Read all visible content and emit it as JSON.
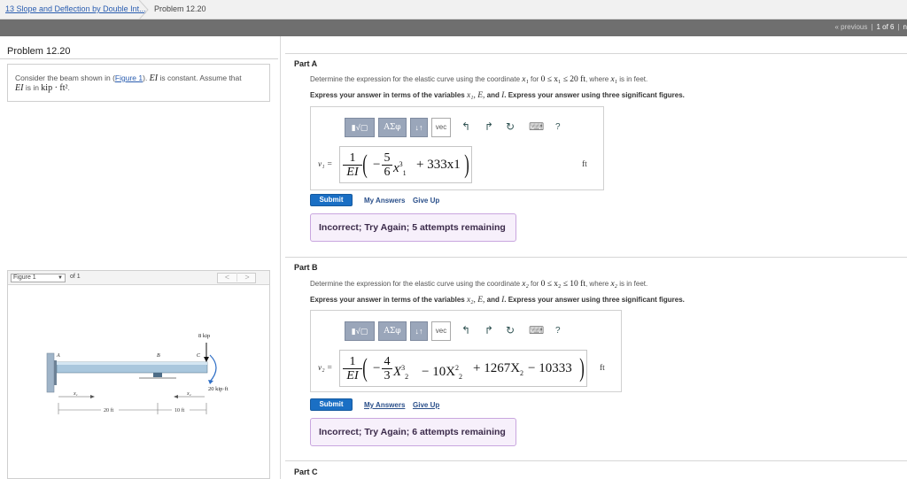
{
  "breadcrumb": {
    "link": "13 Slope and Deflection by Double Int...",
    "current": "Problem 12.20"
  },
  "pager": {
    "previous": "« previous",
    "count": "1 of 6",
    "next": "n"
  },
  "problem": {
    "title": "Problem 12.20",
    "text_pre": "Consider the beam shown in (",
    "figure_link": "Figure 1",
    "text_post": "). ",
    "ei": "EI",
    "constant": " is constant. Assume that",
    "ei2": "EI",
    "units_pre": " is in ",
    "units": "kip · ft²",
    "units_post": "."
  },
  "figure": {
    "select": "Figure 1",
    "of": "of 1",
    "prev": "<",
    "next": ">",
    "labels": {
      "A": "A",
      "B": "B",
      "C": "C",
      "load": "8 kip",
      "moment": "20 kip·ft",
      "x1": "x₁",
      "x2": "x₂",
      "span1": "20 ft",
      "span2": "10 ft"
    }
  },
  "partA": {
    "label": "Part A",
    "prompt_pre": "Determine the expression for the elastic curve using the coordinate ",
    "var": "x₁",
    "prompt_mid": " for ",
    "range": "0 ≤ x₁ ≤ 20 ft",
    "prompt_mid2": ", where ",
    "var2": "x₁",
    "prompt_post": " is in feet.",
    "express_pre": "Express your answer in terms of the variables ",
    "vars": "x₁, E,",
    "express_and": " and ",
    "var_i": "I",
    "express_post": ". Express your answer using three significant figures.",
    "toolbar": {
      "templates": "▮√▢",
      "symbols": "ΑΣφ",
      "arrows": "↓↑",
      "vec": "vec",
      "undo": "↰",
      "redo": "↱",
      "reset": "↻",
      "keyboard": "⌨",
      "help": "?"
    },
    "answer_label": "v₁ =",
    "frac_num": "1",
    "frac_den": "EI",
    "expr_frac_num": "5",
    "expr_frac_den": "6",
    "expr_minus": "−",
    "expr_x": "x",
    "expr_exp": "3",
    "expr_sub": "1",
    "expr_tail": "+ 333x1",
    "unit": "ft",
    "submit": "Submit",
    "my_answers": "My Answers",
    "give_up": "Give Up",
    "feedback": "Incorrect; Try Again; 5 attempts remaining"
  },
  "partB": {
    "label": "Part B",
    "prompt_pre": "Determine the expression for the elastic curve using the coordinate ",
    "var": "x₂",
    "prompt_mid": " for ",
    "range": "0 ≤ x₂ ≤ 10 ft",
    "prompt_mid2": ", where ",
    "var2": "x₂",
    "prompt_post": " is in feet.",
    "express_pre": "Express your answer in terms of the variables ",
    "vars": "x₂, E,",
    "express_and": " and ",
    "var_i": "I",
    "express_post": ". Express your answer using three significant figures.",
    "toolbar": {
      "templates": "▮√▢",
      "symbols": "ΑΣφ",
      "arrows": "↓↑",
      "vec": "vec",
      "undo": "↰",
      "redo": "↱",
      "reset": "↻",
      "keyboard": "⌨",
      "help": "?"
    },
    "answer_label": "v₂ =",
    "frac_num": "1",
    "frac_den": "EI",
    "expr_frac_num": "4",
    "expr_frac_den": "3",
    "expr_minus": "−",
    "expr_x": "X",
    "expr_exp": "3",
    "expr_sub": "2",
    "expr_tail_a": "− 10X",
    "expr_tail_a_exp": "2",
    "expr_tail_a_sub": "2",
    "expr_tail_b": "+ 1267X",
    "expr_tail_b_sub": "2",
    "expr_tail_c": "− 10333",
    "unit": "ft",
    "submit": "Submit",
    "my_answers": "My Answers",
    "give_up": "Give Up",
    "feedback": "Incorrect; Try Again; 6 attempts remaining"
  },
  "partC": {
    "label": "Part C"
  }
}
